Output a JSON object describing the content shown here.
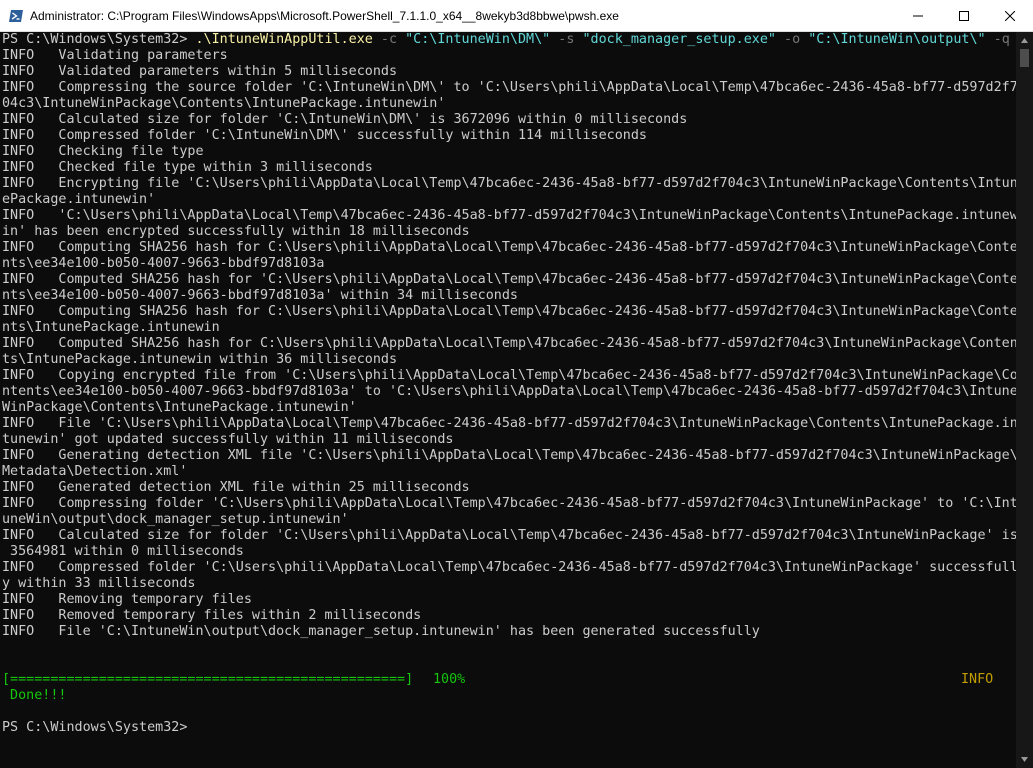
{
  "window": {
    "title": "Administrator: C:\\Program Files\\WindowsApps\\Microsoft.PowerShell_7.1.1.0_x64__8wekyb3d8bbwe\\pwsh.exe"
  },
  "command": {
    "prompt": "PS C:\\Windows\\System32> ",
    "exe": ".\\IntuneWinAppUtil.exe",
    "args": [
      {
        "t": " -c ",
        "c": "gray"
      },
      {
        "t": "\"C:\\IntuneWin\\DM\\\"",
        "c": "cyan"
      },
      {
        "t": " -s ",
        "c": "gray"
      },
      {
        "t": "\"dock_manager_setup.exe\"",
        "c": "cyan"
      },
      {
        "t": " -o ",
        "c": "gray"
      },
      {
        "t": "\"C:\\IntuneWin\\output\\\"",
        "c": "cyan"
      },
      {
        "t": " -q",
        "c": "gray"
      }
    ]
  },
  "output_lines": [
    "INFO   Validating parameters",
    "INFO   Validated parameters within 5 milliseconds",
    "INFO   Compressing the source folder 'C:\\IntuneWin\\DM\\' to 'C:\\Users\\phili\\AppData\\Local\\Temp\\47bca6ec-2436-45a8-bf77-d597d2f7",
    "04c3\\IntuneWinPackage\\Contents\\IntunePackage.intunewin'",
    "INFO   Calculated size for folder 'C:\\IntuneWin\\DM\\' is 3672096 within 0 milliseconds",
    "INFO   Compressed folder 'C:\\IntuneWin\\DM\\' successfully within 114 milliseconds",
    "INFO   Checking file type",
    "INFO   Checked file type within 3 milliseconds",
    "INFO   Encrypting file 'C:\\Users\\phili\\AppData\\Local\\Temp\\47bca6ec-2436-45a8-bf77-d597d2f704c3\\IntuneWinPackage\\Contents\\Intun",
    "ePackage.intunewin'",
    "INFO   'C:\\Users\\phili\\AppData\\Local\\Temp\\47bca6ec-2436-45a8-bf77-d597d2f704c3\\IntuneWinPackage\\Contents\\IntunePackage.intunew",
    "in' has been encrypted successfully within 18 milliseconds",
    "INFO   Computing SHA256 hash for C:\\Users\\phili\\AppData\\Local\\Temp\\47bca6ec-2436-45a8-bf77-d597d2f704c3\\IntuneWinPackage\\Conte",
    "nts\\ee34e100-b050-4007-9663-bbdf97d8103a",
    "INFO   Computed SHA256 hash for 'C:\\Users\\phili\\AppData\\Local\\Temp\\47bca6ec-2436-45a8-bf77-d597d2f704c3\\IntuneWinPackage\\Conte",
    "nts\\ee34e100-b050-4007-9663-bbdf97d8103a' within 34 milliseconds",
    "INFO   Computing SHA256 hash for C:\\Users\\phili\\AppData\\Local\\Temp\\47bca6ec-2436-45a8-bf77-d597d2f704c3\\IntuneWinPackage\\Conte",
    "nts\\IntunePackage.intunewin",
    "INFO   Computed SHA256 hash for C:\\Users\\phili\\AppData\\Local\\Temp\\47bca6ec-2436-45a8-bf77-d597d2f704c3\\IntuneWinPackage\\Conten",
    "ts\\IntunePackage.intunewin within 36 milliseconds",
    "INFO   Copying encrypted file from 'C:\\Users\\phili\\AppData\\Local\\Temp\\47bca6ec-2436-45a8-bf77-d597d2f704c3\\IntuneWinPackage\\Co",
    "ntents\\ee34e100-b050-4007-9663-bbdf97d8103a' to 'C:\\Users\\phili\\AppData\\Local\\Temp\\47bca6ec-2436-45a8-bf77-d597d2f704c3\\Intune",
    "WinPackage\\Contents\\IntunePackage.intunewin'",
    "INFO   File 'C:\\Users\\phili\\AppData\\Local\\Temp\\47bca6ec-2436-45a8-bf77-d597d2f704c3\\IntuneWinPackage\\Contents\\IntunePackage.in",
    "tunewin' got updated successfully within 11 milliseconds",
    "INFO   Generating detection XML file 'C:\\Users\\phili\\AppData\\Local\\Temp\\47bca6ec-2436-45a8-bf77-d597d2f704c3\\IntuneWinPackage\\",
    "Metadata\\Detection.xml'",
    "INFO   Generated detection XML file within 25 milliseconds",
    "INFO   Compressing folder 'C:\\Users\\phili\\AppData\\Local\\Temp\\47bca6ec-2436-45a8-bf77-d597d2f704c3\\IntuneWinPackage' to 'C:\\Int",
    "uneWin\\output\\dock_manager_setup.intunewin'",
    "INFO   Calculated size for folder 'C:\\Users\\phili\\AppData\\Local\\Temp\\47bca6ec-2436-45a8-bf77-d597d2f704c3\\IntuneWinPackage' is",
    " 3564981 within 0 milliseconds",
    "INFO   Compressed folder 'C:\\Users\\phili\\AppData\\Local\\Temp\\47bca6ec-2436-45a8-bf77-d597d2f704c3\\IntuneWinPackage' successfull",
    "y within 33 milliseconds",
    "INFO   Removing temporary files",
    "INFO   Removed temporary files within 2 milliseconds",
    "INFO   File 'C:\\IntuneWin\\output\\dock_manager_setup.intunewin' has been generated successfully"
  ],
  "progress": {
    "bar": "[=================================================]",
    "percent": "100%",
    "percent_value": 100,
    "level": "INFO",
    "done": " Done!!!"
  },
  "final_prompt": "PS C:\\Windows\\System32>",
  "colors": {
    "background": "#0c0c0c",
    "text": "#cccccc",
    "exe": "#f9f1a5",
    "param": "#767676",
    "string": "#61d6d6",
    "progress": "#16c60c",
    "level": "#c19c00"
  }
}
